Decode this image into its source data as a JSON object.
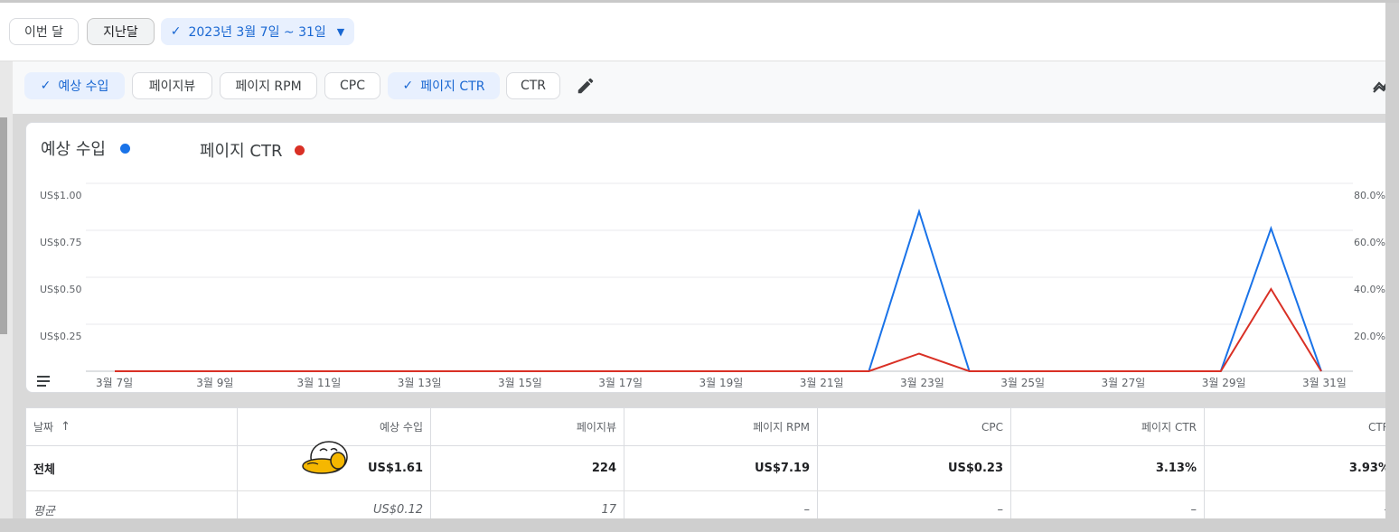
{
  "date_presets": {
    "this_month": "이번 달",
    "last_month": "지난달",
    "range": "2023년 3월 7일 ~ 31일"
  },
  "metric_chips": [
    {
      "label": "예상 수입",
      "selected": true
    },
    {
      "label": "페이지뷰",
      "selected": false
    },
    {
      "label": "페이지 RPM",
      "selected": false
    },
    {
      "label": "CPC",
      "selected": false
    },
    {
      "label": "페이지 CTR",
      "selected": true
    },
    {
      "label": "CTR",
      "selected": false
    }
  ],
  "icons": {
    "check": "check-icon",
    "caret": "caret-down-icon",
    "edit": "pencil-icon",
    "settings": "gear-icon",
    "trend": "trend-icon",
    "menu": "menu-icon",
    "sort": "arrow-up-icon"
  },
  "colors": {
    "series_revenue": "#1a73e8",
    "series_ctr": "#d93025",
    "selected_chip_bg": "#e8f0fe"
  },
  "chart_data": {
    "type": "line",
    "x": [
      "3월 7일",
      "3월 8일",
      "3월 9일",
      "3월 10일",
      "3월 11일",
      "3월 12일",
      "3월 13일",
      "3월 14일",
      "3월 15일",
      "3월 16일",
      "3월 17일",
      "3월 18일",
      "3월 19일",
      "3월 20일",
      "3월 21일",
      "3월 22일",
      "3월 23일",
      "3월 24일",
      "3월 25일",
      "3월 26일",
      "3월 27일",
      "3월 28일",
      "3월 29일",
      "3월 30일",
      "3월 31일"
    ],
    "x_tick_labels": [
      "3월 7일",
      "3월 9일",
      "3월 11일",
      "3월 13일",
      "3월 15일",
      "3월 17일",
      "3월 19일",
      "3월 21일",
      "3월 23일",
      "3월 25일",
      "3월 27일",
      "3월 29일",
      "3월 31일"
    ],
    "series": [
      {
        "name": "예상 수입",
        "axis": "left",
        "color": "#1a73e8",
        "values": [
          0,
          0,
          0,
          0,
          0,
          0,
          0,
          0,
          0,
          0,
          0,
          0,
          0,
          0,
          0,
          0,
          0.85,
          0,
          0,
          0,
          0,
          0,
          0,
          0.76,
          0
        ]
      },
      {
        "name": "페이지 CTR",
        "axis": "right",
        "color": "#d93025",
        "values": [
          0,
          0,
          0,
          0,
          0,
          0,
          0,
          0,
          0,
          0,
          0,
          0,
          0,
          0,
          0,
          0,
          7.5,
          0,
          0,
          0,
          0,
          0,
          0,
          35.0,
          0
        ]
      }
    ],
    "y_left": {
      "ticks": [
        "US$1.00",
        "US$0.75",
        "US$0.50",
        "US$0.25"
      ],
      "ylim": [
        0,
        1.0
      ]
    },
    "y_right": {
      "ticks": [
        "80.0%",
        "60.0%",
        "40.0%",
        "20.0%"
      ],
      "ylim": [
        0,
        80
      ]
    },
    "grid": true,
    "legend": "top-left"
  },
  "table": {
    "headers": [
      "날짜",
      "예상 수입",
      "페이지뷰",
      "페이지 RPM",
      "CPC",
      "페이지 CTR",
      "CTR"
    ],
    "total": [
      "전체",
      "US$1.61",
      "224",
      "US$7.19",
      "US$0.23",
      "3.13%",
      "3.93%"
    ],
    "average": [
      "평균",
      "US$0.12",
      "17",
      "–",
      "–",
      "–",
      "–"
    ]
  }
}
